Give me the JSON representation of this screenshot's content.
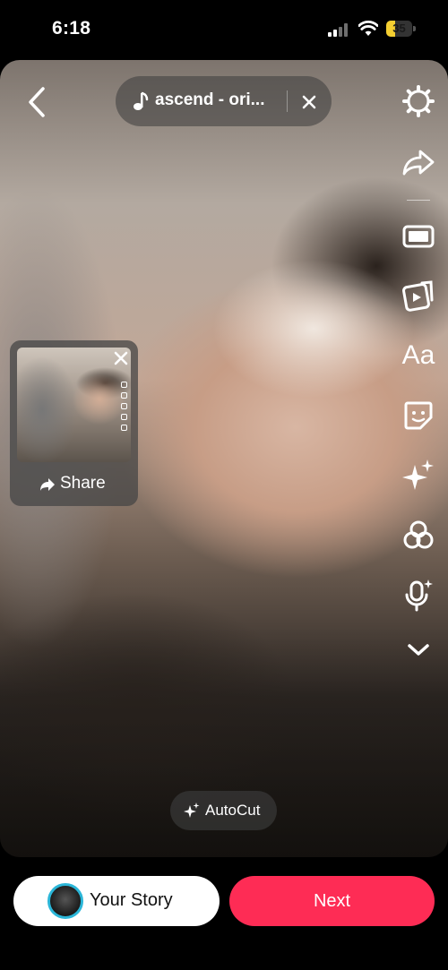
{
  "status_bar": {
    "time": "6:18",
    "battery_level": "35",
    "battery_fraction": 0.35,
    "icons": [
      "signal-icon",
      "wifi-icon",
      "battery-icon"
    ]
  },
  "top_bar": {
    "back_icon": "chevron-left-icon",
    "sound": {
      "icon": "music-note-icon",
      "title": "ascend - ori...",
      "remove_icon": "close-icon"
    }
  },
  "toolbar": {
    "items": [
      {
        "name": "settings",
        "icon": "gear-icon"
      },
      {
        "name": "share",
        "icon": "share-arrow-icon"
      },
      {
        "name": "adjust-clips",
        "icon": "film-strip-icon"
      },
      {
        "name": "templates",
        "icon": "video-template-icon"
      },
      {
        "name": "text",
        "label": "Aa"
      },
      {
        "name": "stickers",
        "icon": "sticker-icon"
      },
      {
        "name": "effects",
        "icon": "sparkles-icon"
      },
      {
        "name": "filters",
        "icon": "filters-icon"
      },
      {
        "name": "voice",
        "icon": "voice-effects-icon"
      },
      {
        "name": "more",
        "icon": "chevron-down-icon"
      }
    ]
  },
  "share_card": {
    "label": "Share",
    "icon": "share-arrow-icon",
    "close_icon": "close-icon"
  },
  "autocut": {
    "label": "AutoCut",
    "icon": "sparkles-icon"
  },
  "bottom": {
    "your_story_label": "Your Story",
    "next_label": "Next"
  },
  "colors": {
    "next_button": "#fe2c55",
    "battery": "#f5cf31",
    "avatar_ring": "#2bb6d8"
  }
}
